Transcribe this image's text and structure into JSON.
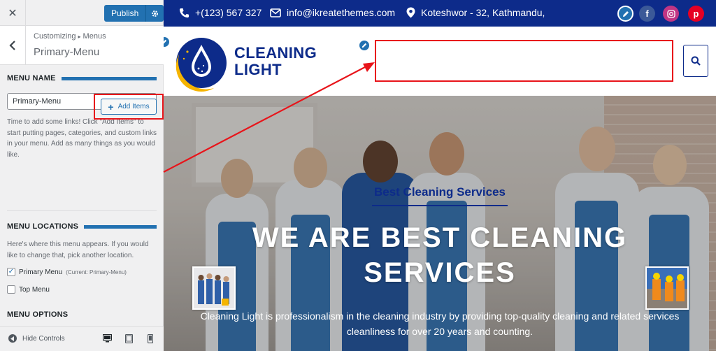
{
  "customizer": {
    "close_icon": "close-icon",
    "publish_label": "Publish",
    "breadcrumb": [
      "Customizing",
      "Menus"
    ],
    "panel_title": "Primary-Menu",
    "menu_name": {
      "heading": "MENU NAME",
      "value": "Primary-Menu",
      "description": "Time to add some links! Click \"Add Items\" to start putting pages, categories, and custom links in your menu. Add as many things as you would like.",
      "add_items_label": "Add Items"
    },
    "menu_locations": {
      "heading": "MENU LOCATIONS",
      "description": "Here's where this menu appears. If you would like to change that, pick another location.",
      "primary_label": "Primary Menu",
      "primary_note": "(Current: Primary-Menu)",
      "primary_checked": true,
      "top_label": "Top Menu",
      "top_checked": false
    },
    "menu_options": {
      "heading": "MENU OPTIONS"
    },
    "footer": {
      "hide_controls_label": "Hide Controls"
    }
  },
  "site": {
    "topbar": {
      "phone": "+(123) 567 327",
      "email": "info@ikreatethemes.com",
      "address": "Koteshwor - 32, Kathmandu,"
    },
    "logo": {
      "line1": "CLEANING",
      "line2": "LIGHT"
    },
    "hero": {
      "eyebrow": "Best Cleaning Services",
      "title": "WE ARE BEST CLEANING SERVICES",
      "description": "Cleaning Light is professionalism in the cleaning industry by providing top-quality cleaning and related services cleanliness for over 20 years and counting."
    }
  },
  "colors": {
    "brand_navy": "#0d2b8a",
    "wp_blue": "#2271b1",
    "annotation_red": "#e8141a",
    "logo_yellow": "#f5b400"
  }
}
